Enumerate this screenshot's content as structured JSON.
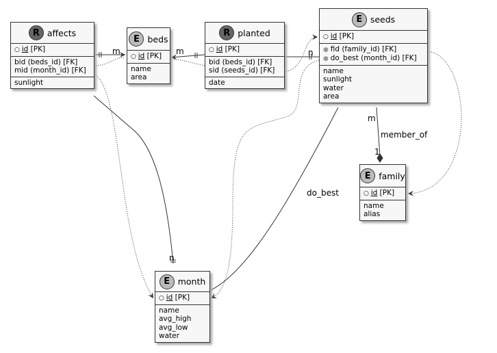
{
  "entities": {
    "affects": {
      "kind": "R",
      "name": "affects",
      "pk": "id",
      "pk_suffix": "[PK]",
      "fks": [
        "bid (beds_id) [FK]",
        "mid (month_id) [FK]"
      ],
      "attrs": [
        "sunlight"
      ]
    },
    "beds": {
      "kind": "E",
      "name": "beds",
      "pk": "id",
      "pk_suffix": "[PK]",
      "attrs": [
        "name",
        "area"
      ]
    },
    "planted": {
      "kind": "R",
      "name": "planted",
      "pk": "id",
      "pk_suffix": "[PK]",
      "fks": [
        "bid (beds_id) [FK]",
        "sid (seeds_id) [FK]"
      ],
      "attrs": [
        "date"
      ]
    },
    "seeds": {
      "kind": "E",
      "name": "seeds",
      "pk": "id",
      "pk_suffix": "[PK]",
      "fks": [
        "fid (family_id) [FK]",
        "do_best (month_id) [FK]"
      ],
      "attrs": [
        "name",
        "sunlight",
        "water",
        "area"
      ]
    },
    "family": {
      "kind": "E",
      "name": "family",
      "pk": "id",
      "pk_suffix": "[PK]",
      "attrs": [
        "name",
        "alias"
      ]
    },
    "month": {
      "kind": "E",
      "name": "month",
      "pk": "id",
      "pk_suffix": "[PK]",
      "attrs": [
        "name",
        "avg_high",
        "avg_low",
        "water"
      ]
    }
  },
  "labels": {
    "m1": "m",
    "m2": "m",
    "n1": "n",
    "n2": "n",
    "m3": "m",
    "one": "1",
    "member_of": "member_of",
    "do_best": "do_best"
  }
}
